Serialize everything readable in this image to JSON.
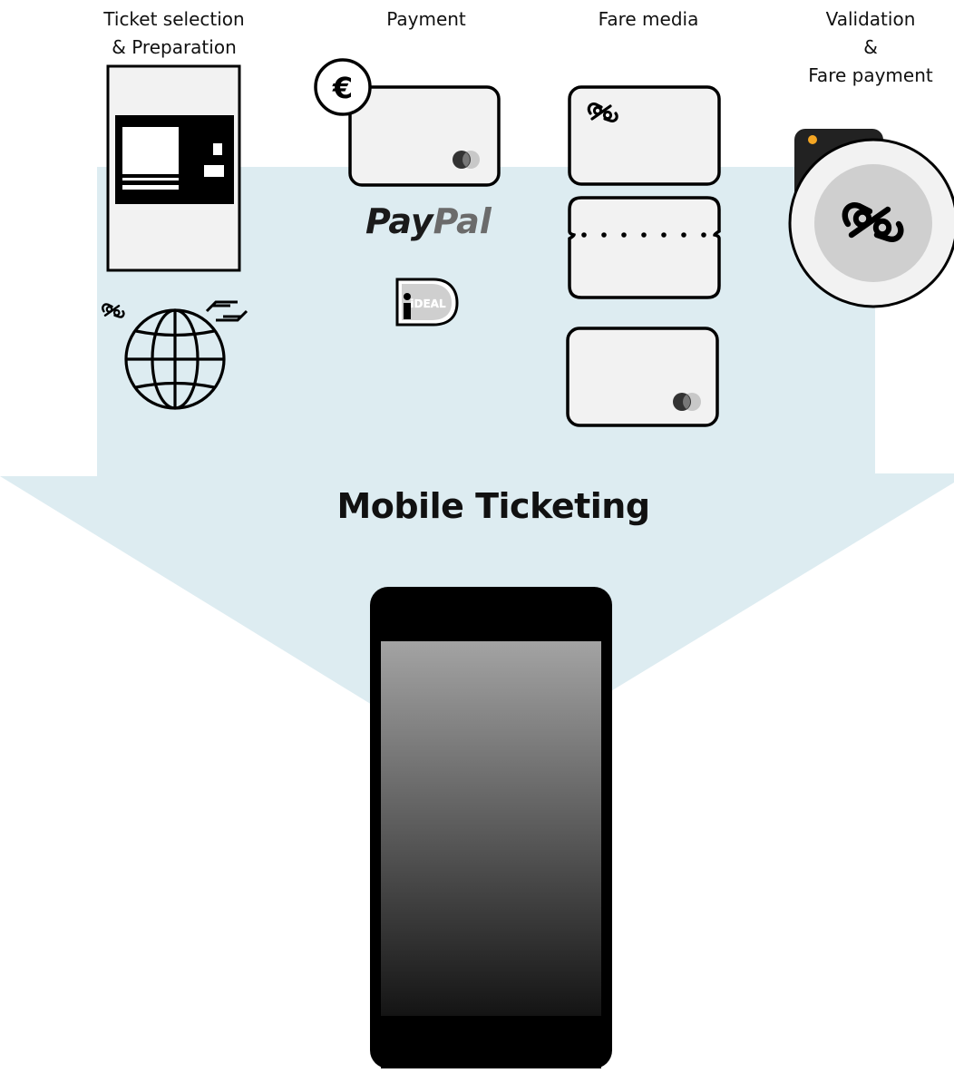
{
  "columns": {
    "ticket_selection": {
      "title": "Ticket selection\n& Preparation"
    },
    "payment": {
      "title": "Payment"
    },
    "fare_media": {
      "title": "Fare media"
    },
    "validation": {
      "title": "Validation\n&\nFare payment"
    }
  },
  "payment_methods": {
    "currency_symbol": "€",
    "paypal_pay": "Pay",
    "paypal_pal": "Pal",
    "ideal_logo": "iDEAL"
  },
  "main": {
    "title": "Mobile Ticketing"
  },
  "colors": {
    "arrow_fill": "#ddecf1",
    "outline": "#000000",
    "card_fill": "#f2f2f2",
    "paypal_dark": "#1a1a1a",
    "paypal_light": "#6b6b6b",
    "validator_accent": "#f5a623",
    "phone_screen_top": "#a3a3a3",
    "phone_screen_bottom": "#000000"
  },
  "icons": {
    "ticket_machine": "ticket-machine-icon",
    "web": "globe-icon",
    "ov_logo": "ov-chipkaart-logo-icon",
    "ns_logo": "ns-logo-icon",
    "euro": "euro-coin-icon",
    "bank_card": "bank-card-icon",
    "paypal": "paypal-logo",
    "ideal": "ideal-logo",
    "ov_card": "ov-chipkaart-card-icon",
    "paper_ticket": "paper-ticket-icon",
    "contactless_card": "contactless-bank-card-icon",
    "validator": "validator-icon",
    "phone": "smartphone-icon"
  }
}
